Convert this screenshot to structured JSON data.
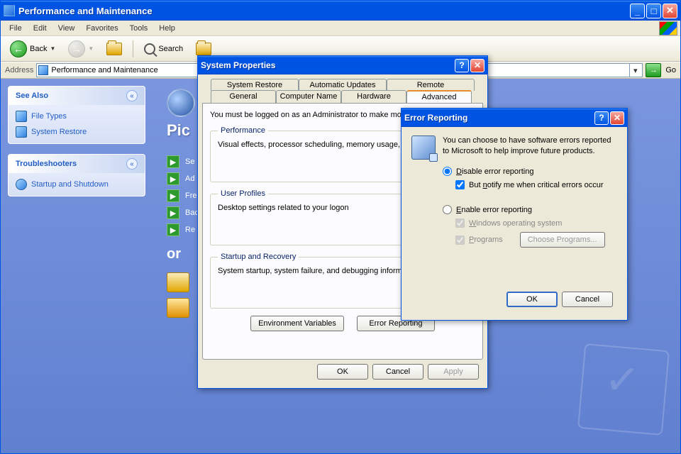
{
  "window": {
    "title": "Performance and Maintenance"
  },
  "menu": {
    "file": "File",
    "edit": "Edit",
    "view": "View",
    "favorites": "Favorites",
    "tools": "Tools",
    "help": "Help"
  },
  "toolbar": {
    "back": "Back",
    "search": "Search"
  },
  "address": {
    "label": "Address",
    "value": "Performance and Maintenance",
    "go": "Go"
  },
  "sidebar": {
    "seealso": {
      "title": "See Also",
      "items": [
        "File Types",
        "System Restore"
      ]
    },
    "troubleshooters": {
      "title": "Troubleshooters",
      "items": [
        "Startup and Shutdown"
      ]
    }
  },
  "mainpane": {
    "heading_prefix": "Pic",
    "tasks": [
      "Se",
      "Ad",
      "Fre",
      "Bac",
      "Re"
    ],
    "or": "or"
  },
  "sysprops": {
    "title": "System Properties",
    "tabs_row1": [
      "System Restore",
      "Automatic Updates",
      "Remote"
    ],
    "tabs_row2": [
      "General",
      "Computer Name",
      "Hardware",
      "Advanced"
    ],
    "active_tab": "Advanced",
    "admin_text": "You must be logged on as an Administrator to make mo",
    "perf": {
      "legend": "Performance",
      "text": "Visual effects, processor scheduling, memory usage, a"
    },
    "profiles": {
      "legend": "User Profiles",
      "text": "Desktop settings related to your logon"
    },
    "startup": {
      "legend": "Startup and Recovery",
      "text": "System startup, system failure, and debugging informat"
    },
    "envvars": "Environment Variables",
    "errrep": "Error Reporting",
    "ok": "OK",
    "cancel": "Cancel",
    "apply": "Apply"
  },
  "errrep": {
    "title": "Error Reporting",
    "desc": "You can choose to have software errors reported to Microsoft to help improve future products.",
    "disable": "Disable error reporting",
    "notify": "But notify me when critical errors occur",
    "enable": "Enable error reporting",
    "win_os": "Windows operating system",
    "programs": "Programs",
    "choose": "Choose Programs...",
    "ok": "OK",
    "cancel": "Cancel"
  }
}
